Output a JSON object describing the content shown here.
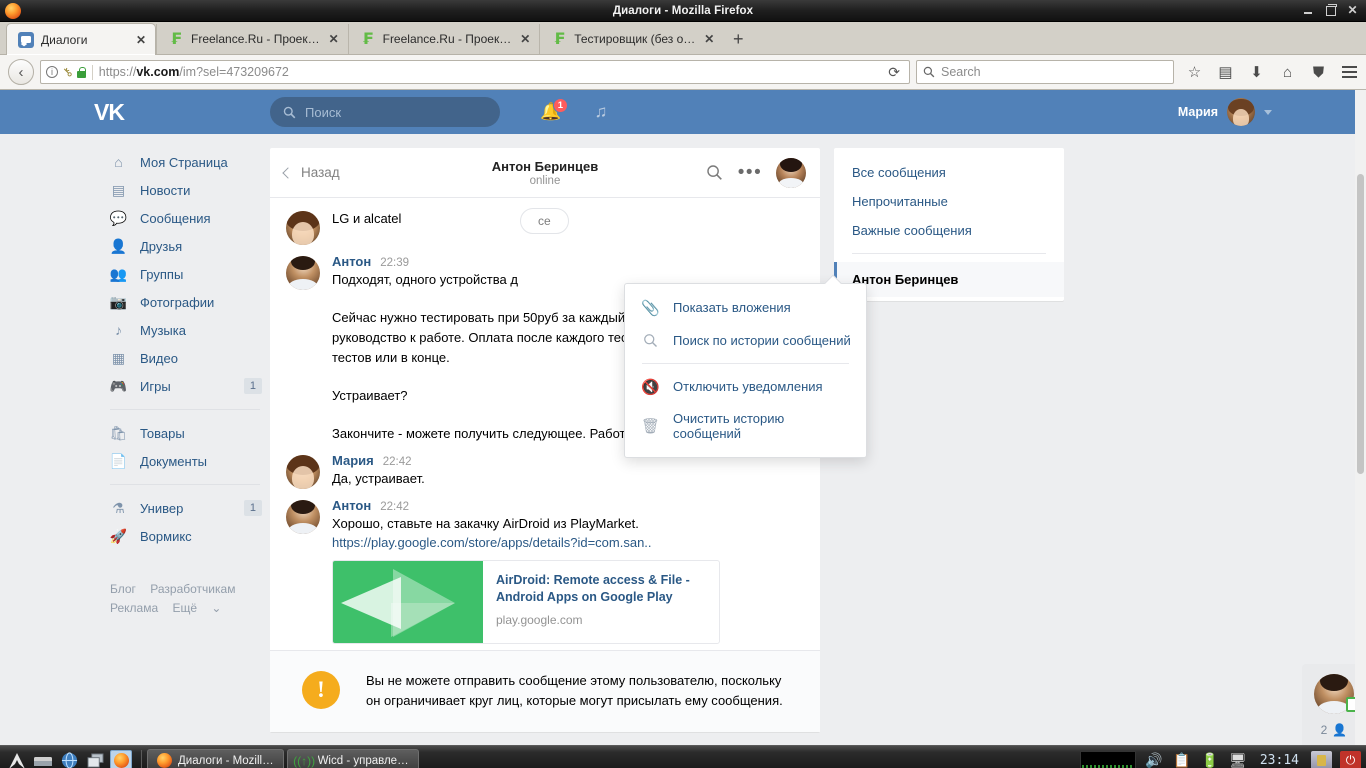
{
  "window": {
    "title": "Диалоги - Mozilla Firefox",
    "minimize_label": "–",
    "maximize_label": "❐",
    "close_label": "✕"
  },
  "browser": {
    "tabs": [
      {
        "label": "Диалоги",
        "favicon": "vk-icon",
        "active": true,
        "close_label": "✕"
      },
      {
        "label": "Freelance.Ru - Проек…",
        "favicon": "freelance-icon",
        "active": false,
        "close_label": "✕"
      },
      {
        "label": "Freelance.Ru - Проек…",
        "favicon": "freelance-icon",
        "active": false,
        "close_label": "✕"
      },
      {
        "label": "Тестировщик (без о…",
        "favicon": "freelance-icon",
        "active": false,
        "close_label": "✕"
      }
    ],
    "new_tab_label": "+",
    "back_label": "‹",
    "url_prefix": "https://",
    "url_host": "vk.com",
    "url_path": "/im?sel=473209672",
    "reload_label": "⟳",
    "search_placeholder": "Search",
    "search_value": "",
    "toolbar_icons": [
      "bookmark-star-icon",
      "reader-icon",
      "download-icon",
      "home-icon",
      "pocket-icon",
      "menu-icon"
    ]
  },
  "vk_header": {
    "logo": "VK",
    "search_placeholder": "Поиск",
    "search_value": "",
    "notifications_badge": "1",
    "icons": [
      "bell-icon",
      "music-note-icon"
    ],
    "user_name": "Мария"
  },
  "sidebar": {
    "items": [
      {
        "label": "Моя Страница",
        "icon": "home-icon",
        "count": ""
      },
      {
        "label": "Новости",
        "icon": "news-icon",
        "count": ""
      },
      {
        "label": "Сообщения",
        "icon": "messages-icon",
        "count": ""
      },
      {
        "label": "Друзья",
        "icon": "friends-icon",
        "count": ""
      },
      {
        "label": "Группы",
        "icon": "groups-icon",
        "count": ""
      },
      {
        "label": "Фотографии",
        "icon": "photos-icon",
        "count": ""
      },
      {
        "label": "Музыка",
        "icon": "music-icon",
        "count": ""
      },
      {
        "label": "Видео",
        "icon": "video-icon",
        "count": ""
      },
      {
        "label": "Игры",
        "icon": "games-icon",
        "count": "1"
      }
    ],
    "items2": [
      {
        "label": "Товары",
        "icon": "market-icon",
        "count": ""
      },
      {
        "label": "Документы",
        "icon": "documents-icon",
        "count": ""
      }
    ],
    "items3": [
      {
        "label": "Универ",
        "icon": "flask-icon",
        "count": "1"
      },
      {
        "label": "Вормикс",
        "icon": "rocket-icon",
        "count": ""
      }
    ],
    "footer_links": [
      "Блог",
      "Разработчикам",
      "Реклама",
      "Ещё"
    ]
  },
  "chat": {
    "back_label": "Назад",
    "title": "Антон Беринцев",
    "status": "online",
    "search_icon": "search-icon",
    "more_icon": "dots-icon",
    "date_pill": "се",
    "messages": [
      {
        "author": "",
        "time": "",
        "avatar": "maria-avatar",
        "paragraphs": [
          "LG и alcatel"
        ]
      },
      {
        "author": "Антон",
        "time": "22:39",
        "avatar": "anton-avatar",
        "paragraphs": [
          "Подходят, одного устройства д",
          "Сейчас нужно тестировать при 50руб за каждый. Занимает ок пошаговое руководство к работе. Оплата после каждого теста, после каждой пары тестов или в конце.",
          "Устраивает?",
          "Закончите - можете получить следующее. Работы много."
        ]
      },
      {
        "author": "Мария",
        "time": "22:42",
        "avatar": "maria-avatar",
        "paragraphs": [
          "Да, устраивает."
        ]
      },
      {
        "author": "Антон",
        "time": "22:42",
        "avatar": "anton-avatar",
        "paragraphs": [
          "Хорошо, ставьте на закачку AirDroid из PlayMarket."
        ],
        "link": "https://play.google.com/store/apps/details?id=com.san..",
        "card": {
          "title": "AirDroid: Remote access & File - Android Apps on Google Play",
          "domain": "play.google.com",
          "thumb_color": "#3ec06a"
        }
      }
    ],
    "warning": "Вы не можете отправить сообщение этому пользователю, поскольку он ограничивает круг лиц, которые могут присылать ему сообщения.",
    "warning_icon": "exclamation-icon"
  },
  "dropdown": {
    "items": [
      {
        "label": "Показать вложения",
        "icon": "paperclip-icon"
      },
      {
        "label": "Поиск по истории сообщений",
        "icon": "search-icon"
      },
      {
        "label": "Отключить уведомления",
        "icon": "bell-off-icon"
      },
      {
        "label": "Очистить историю сообщений",
        "icon": "trash-icon"
      }
    ]
  },
  "right_panel": {
    "items": [
      {
        "label": "Все сообщения",
        "active": false
      },
      {
        "label": "Непрочитанные",
        "active": false
      },
      {
        "label": "Важные сообщения",
        "active": false
      }
    ],
    "active_item": {
      "label": "Антон Беринцев",
      "active": true
    }
  },
  "fab": {
    "count": "2",
    "person_icon": "person-icon",
    "online_icon": "mobile-online-icon"
  },
  "taskbar": {
    "launchers": [
      "menu-icon",
      "terminal-icon",
      "browser-icon",
      "windows-icon",
      "firefox-icon"
    ],
    "windows": [
      {
        "label": "Диалоги - Mozill…",
        "icon": "firefox-icon"
      },
      {
        "label": "Wicd - управле…",
        "icon": "wicd-icon"
      }
    ],
    "tray_icons": [
      "network-graph",
      "volume-icon",
      "clipboard-icon",
      "battery-icon",
      "display-icon"
    ],
    "clock": "23:14",
    "lock_icon": "lock-icon",
    "power_icon": "power-icon"
  },
  "colors": {
    "vk_blue": "#5181b8",
    "page_bg": "#edeef0",
    "link": "#2a5885",
    "warning": "#f5ac1d",
    "green": "#3ec06a"
  }
}
